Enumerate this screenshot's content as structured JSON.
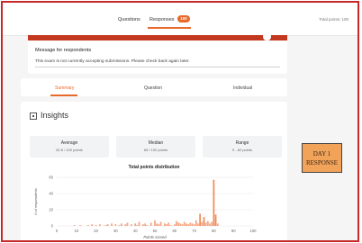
{
  "header": {
    "tab_questions": "Questions",
    "tab_responses": "Responses",
    "responses_count": "100",
    "total_points": "Total points: 100"
  },
  "message_card": {
    "label": "Message for respondents",
    "text": "This exam is not currently accepting submissions. Please check back again later."
  },
  "subtabs": {
    "summary": "Summary",
    "question": "Question",
    "individual": "Individual"
  },
  "insights": {
    "title": "Insights",
    "icon": "insights-icon",
    "average_label": "Average",
    "average_value": "62.8 / 100 points",
    "median_label": "Median",
    "median_value": "65 / 100 points",
    "range_label": "Range",
    "range_value": "9 - 82 points"
  },
  "stamp": {
    "line1": "DAY 1",
    "line2": "RESPONSE"
  },
  "colors": {
    "accent": "#e8692b",
    "banner": "#c2391f",
    "border": "#c62828",
    "bar": "#f4a582",
    "bar_strong": "#f08a5a",
    "stamp": "#f1a35a"
  },
  "chart_data": {
    "type": "bar",
    "title": "Total points distribution",
    "xlabel": "Points scored",
    "ylabel": "# of respondents",
    "xlim": [
      0,
      100
    ],
    "ylim": [
      0,
      60
    ],
    "xticks": [
      0,
      10,
      20,
      30,
      40,
      50,
      60,
      70,
      80,
      90,
      100
    ],
    "yticks": [
      0,
      20,
      40,
      60
    ],
    "x": [
      9,
      12,
      16,
      18,
      20,
      22,
      25,
      26,
      28,
      30,
      32,
      33,
      35,
      36,
      38,
      40,
      41,
      42,
      44,
      45,
      46,
      48,
      50,
      51,
      52,
      53,
      55,
      56,
      57,
      58,
      60,
      61,
      62,
      63,
      64,
      65,
      66,
      67,
      68,
      69,
      70,
      71,
      72,
      73,
      74,
      75,
      76,
      77,
      78,
      79,
      80,
      81,
      82
    ],
    "values": [
      1,
      1,
      1,
      2,
      1,
      2,
      1,
      2,
      3,
      2,
      1,
      3,
      2,
      4,
      2,
      3,
      1,
      5,
      2,
      3,
      1,
      4,
      7,
      3,
      2,
      5,
      3,
      2,
      4,
      1,
      2,
      6,
      4,
      3,
      2,
      5,
      3,
      2,
      4,
      3,
      2,
      7,
      3,
      15,
      5,
      11,
      4,
      6,
      3,
      5,
      57,
      14,
      3
    ]
  }
}
